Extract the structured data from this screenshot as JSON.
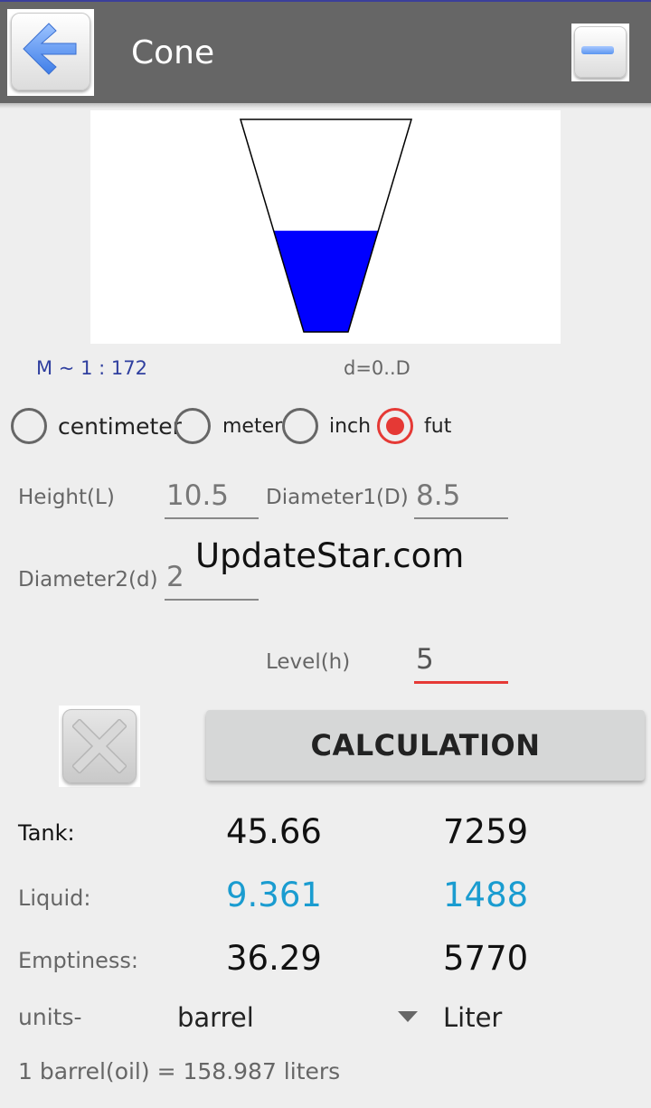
{
  "app": {
    "title": "Cone"
  },
  "diagram": {
    "fill_level_fraction": 0.476,
    "liquid_color": "#0000ff"
  },
  "scale_text": "M ~ 1 : 172",
  "range_text": "d=0..D",
  "units_radio": {
    "options": [
      "centimeter",
      "meter",
      "inch",
      "fut"
    ],
    "selected": "fut"
  },
  "inputs": {
    "height_label": "Height(L)",
    "height_value": "10.5",
    "diameter1_label": "Diameter1(D)",
    "diameter1_value": "8.5",
    "diameter2_label": "Diameter2(d)",
    "diameter2_value": "2",
    "level_label": "Level(h)",
    "level_value": "5"
  },
  "watermark": "UpdateStar.com",
  "calc_button_label": "CALCULATION",
  "results": {
    "tank_label": "Tank:",
    "tank_barrel": "45.66",
    "tank_liter": "7259",
    "liquid_label": "Liquid:",
    "liquid_barrel": "9.361",
    "liquid_liter": "1488",
    "empty_label": "Emptiness:",
    "empty_barrel": "36.29",
    "empty_liter": "5770"
  },
  "units": {
    "label": "units-",
    "selected": "barrel",
    "second_unit": "Liter",
    "note": "1 barrel(oil) = 158.987 liters"
  },
  "colors": {
    "accent": "#e53935",
    "liquid_text": "#1a9cd0",
    "appbar": "#666666"
  }
}
